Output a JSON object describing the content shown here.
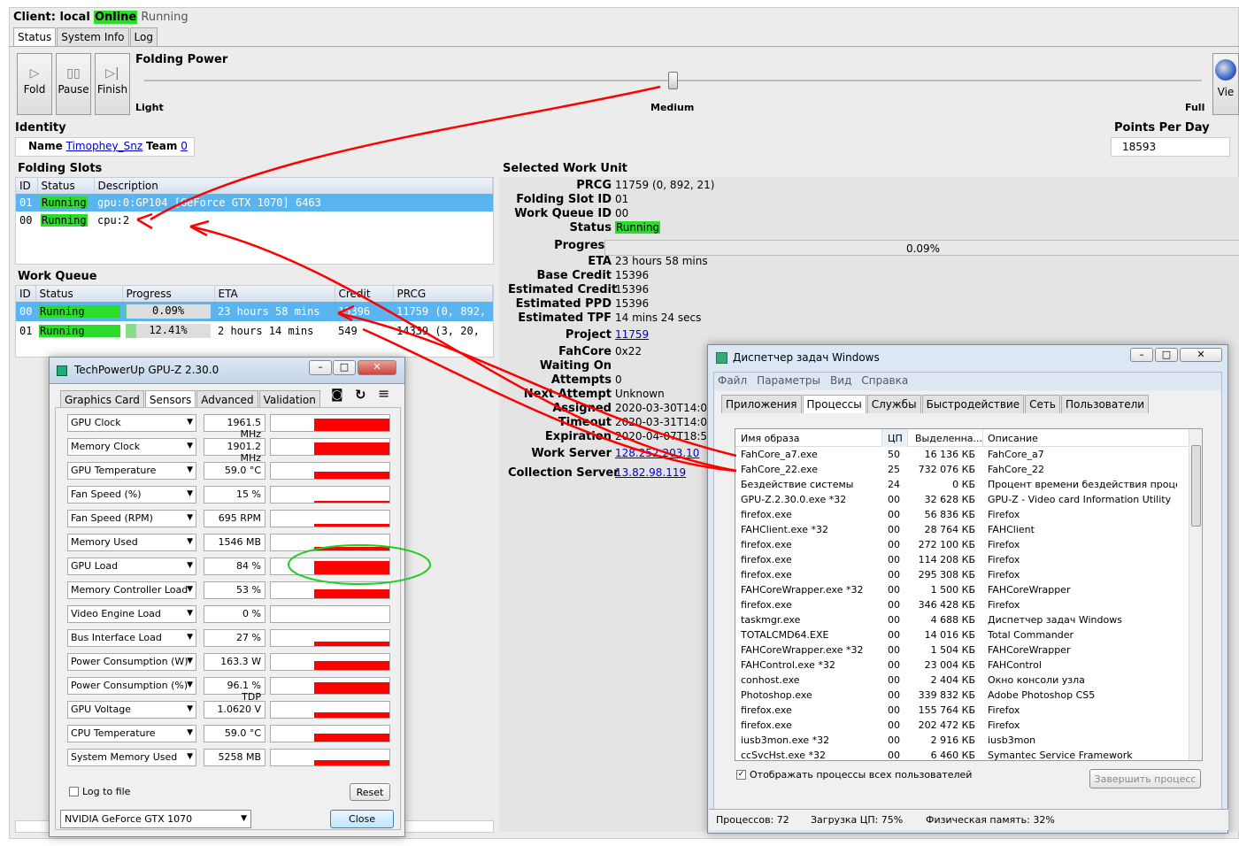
{
  "fah": {
    "client_label": "Client: local",
    "client_online": "Online",
    "client_running": "Running",
    "tabs": [
      "Status",
      "System Info",
      "Log"
    ],
    "buttons": {
      "fold": "Fold",
      "pause": "Pause",
      "finish": "Finish"
    },
    "folding_power": {
      "title": "Folding Power",
      "light": "Light",
      "medium": "Medium",
      "full": "Full",
      "level": 0.5
    },
    "view_partial": "Vie",
    "identity": {
      "title": "Identity",
      "name_label": "Name",
      "name": "Timophey_Snz",
      "team_label": "Team",
      "team": "0"
    },
    "ppd": {
      "title": "Points Per Day",
      "value": "18593"
    },
    "slots": {
      "title": "Folding Slots",
      "headers": [
        "ID",
        "Status",
        "Description"
      ],
      "rows": [
        {
          "id": "01",
          "status": "Running",
          "desc": "gpu:0:GP104 [GeForce GTX 1070] 6463"
        },
        {
          "id": "00",
          "status": "Running",
          "desc": "cpu:2"
        }
      ]
    },
    "queue": {
      "title": "Work Queue",
      "headers": [
        "ID",
        "Status",
        "Progress",
        "ETA",
        "Credit",
        "PRCG"
      ],
      "rows": [
        {
          "id": "00",
          "status": "Running",
          "progress": "0.09%",
          "pct": 0.09,
          "eta": "23 hours 58 mins",
          "credit": "15396",
          "prcg": "11759 (0, 892,"
        },
        {
          "id": "01",
          "status": "Running",
          "progress": "12.41%",
          "pct": 12.41,
          "eta": "2 hours 14 mins",
          "credit": "549",
          "prcg": "14339 (3, 20,"
        }
      ]
    },
    "wu": {
      "title": "Selected Work Unit",
      "prcg_label": "PRCG",
      "prcg": "11759 (0, 892, 21)",
      "slot_label": "Folding Slot ID",
      "slot": "01",
      "queue_label": "Work Queue ID",
      "queue": "00",
      "status_label": "Status",
      "status": "Running",
      "progress_label": "Progress",
      "progress": "0.09%",
      "eta_label": "ETA",
      "eta": "23 hours 58 mins",
      "base_credit_label": "Base Credit",
      "base_credit": "15396",
      "est_credit_label": "Estimated Credit",
      "est_credit": "15396",
      "est_ppd_label": "Estimated PPD",
      "est_ppd": "15396",
      "est_tpf_label": "Estimated TPF",
      "est_tpf": "14 mins 24 secs",
      "project_label": "Project",
      "project": "11759",
      "fahcore_label": "FahCore",
      "fahcore": "0x22",
      "waiting_label": "Waiting On",
      "attempts_label": "Attempts",
      "attempts": "0",
      "next_label": "Next Attempt",
      "next": "Unknown",
      "assigned_label": "Assigned",
      "assigned": "2020-03-30T14:02:1",
      "timeout_label": "Timeout",
      "timeout": "2020-03-31T14:02:1",
      "expiration_label": "Expiration",
      "expiration": "2020-04-07T18:50:",
      "ws_label": "Work Server",
      "ws": "128.252.203.10",
      "cs_label": "Collection Server",
      "cs": "13.82.98.119"
    }
  },
  "gpuz": {
    "title": "TechPowerUp GPU-Z 2.30.0",
    "tabs": [
      "Graphics Card",
      "Sensors",
      "Advanced",
      "Validation"
    ],
    "sensors": [
      {
        "name": "GPU Clock",
        "value": "1961.5 MHz",
        "level": 0.8
      },
      {
        "name": "Memory Clock",
        "value": "1901.2 MHz",
        "level": 0.8
      },
      {
        "name": "GPU Temperature",
        "value": "59.0 °C",
        "level": 0.45
      },
      {
        "name": "Fan Speed (%)",
        "value": "15 %",
        "level": 0.1
      },
      {
        "name": "Fan Speed (RPM)",
        "value": "695 RPM",
        "level": 0.15
      },
      {
        "name": "Memory Used",
        "value": "1546 MB",
        "level": 0.2
      },
      {
        "name": "GPU Load",
        "value": "84 %",
        "level": 0.84
      },
      {
        "name": "Memory Controller Load",
        "value": "53 %",
        "level": 0.53
      },
      {
        "name": "Video Engine Load",
        "value": "0 %",
        "level": 0
      },
      {
        "name": "Bus Interface Load",
        "value": "27 %",
        "level": 0.27
      },
      {
        "name": "Power Consumption (W)",
        "value": "163.3 W",
        "level": 0.55
      },
      {
        "name": "Power Consumption (%)",
        "value": "96.1 % TDP",
        "level": 0.7
      },
      {
        "name": "GPU Voltage",
        "value": "1.0620 V",
        "level": 0.35
      },
      {
        "name": "CPU Temperature",
        "value": "59.0 °C",
        "level": 0.5
      },
      {
        "name": "System Memory Used",
        "value": "5258 MB",
        "level": 0.35
      }
    ],
    "log_to_file": "Log to file",
    "reset": "Reset",
    "device": "NVIDIA GeForce GTX 1070",
    "close": "Close"
  },
  "tm": {
    "title": "Диспетчер задач Windows",
    "menu": [
      "Файл",
      "Параметры",
      "Вид",
      "Справка"
    ],
    "tabs": [
      "Приложения",
      "Процессы",
      "Службы",
      "Быстродействие",
      "Сеть",
      "Пользователи"
    ],
    "headers": [
      "Имя образа",
      "ЦП",
      "Выделенна...",
      "Описание"
    ],
    "rows": [
      [
        "FahCore_a7.exe",
        "50",
        "16 136 КБ",
        "FahCore_a7"
      ],
      [
        "FahCore_22.exe",
        "25",
        "732 076 КБ",
        "FahCore_22"
      ],
      [
        "Бездействие системы",
        "24",
        "0 КБ",
        "Процент времени бездействия процесс..."
      ],
      [
        "GPU-Z.2.30.0.exe *32",
        "00",
        "32 628 КБ",
        "GPU-Z - Video card Information Utility"
      ],
      [
        "firefox.exe",
        "00",
        "56 836 КБ",
        "Firefox"
      ],
      [
        "FAHClient.exe *32",
        "00",
        "28 764 КБ",
        "FAHClient"
      ],
      [
        "firefox.exe",
        "00",
        "272 100 КБ",
        "Firefox"
      ],
      [
        "firefox.exe",
        "00",
        "114 208 КБ",
        "Firefox"
      ],
      [
        "firefox.exe",
        "00",
        "295 308 КБ",
        "Firefox"
      ],
      [
        "FAHCoreWrapper.exe *32",
        "00",
        "1 500 КБ",
        "FAHCoreWrapper"
      ],
      [
        "firefox.exe",
        "00",
        "346 428 КБ",
        "Firefox"
      ],
      [
        "taskmgr.exe",
        "00",
        "4 688 КБ",
        "Диспетчер задач Windows"
      ],
      [
        "TOTALCMD64.EXE",
        "00",
        "14 016 КБ",
        "Total Commander"
      ],
      [
        "FAHCoreWrapper.exe *32",
        "00",
        "1 504 КБ",
        "FAHCoreWrapper"
      ],
      [
        "FAHControl.exe *32",
        "00",
        "23 004 КБ",
        "FAHControl"
      ],
      [
        "conhost.exe",
        "00",
        "2 404 КБ",
        "Окно консоли узла"
      ],
      [
        "Photoshop.exe",
        "00",
        "339 832 КБ",
        "Adobe Photoshop CS5"
      ],
      [
        "firefox.exe",
        "00",
        "155 764 КБ",
        "Firefox"
      ],
      [
        "firefox.exe",
        "00",
        "202 472 КБ",
        "Firefox"
      ],
      [
        "iusb3mon.exe *32",
        "00",
        "2 916 КБ",
        "iusb3mon"
      ],
      [
        "ccSvcHst.exe *32",
        "00",
        "6 460 КБ",
        "Symantec Service Framework"
      ]
    ],
    "show_all": "Отображать процессы всех пользователей",
    "end_process": "Завершить процесс",
    "status_procs": "Процессов: 72",
    "status_cpu": "Загрузка ЦП: 75%",
    "status_mem": "Физическая память: 32%"
  },
  "colors": {
    "running": "#2bdc2b",
    "selected": "#5ab4f0",
    "annotation_red": "#ff0000",
    "annotation_green": "#22cc22"
  }
}
